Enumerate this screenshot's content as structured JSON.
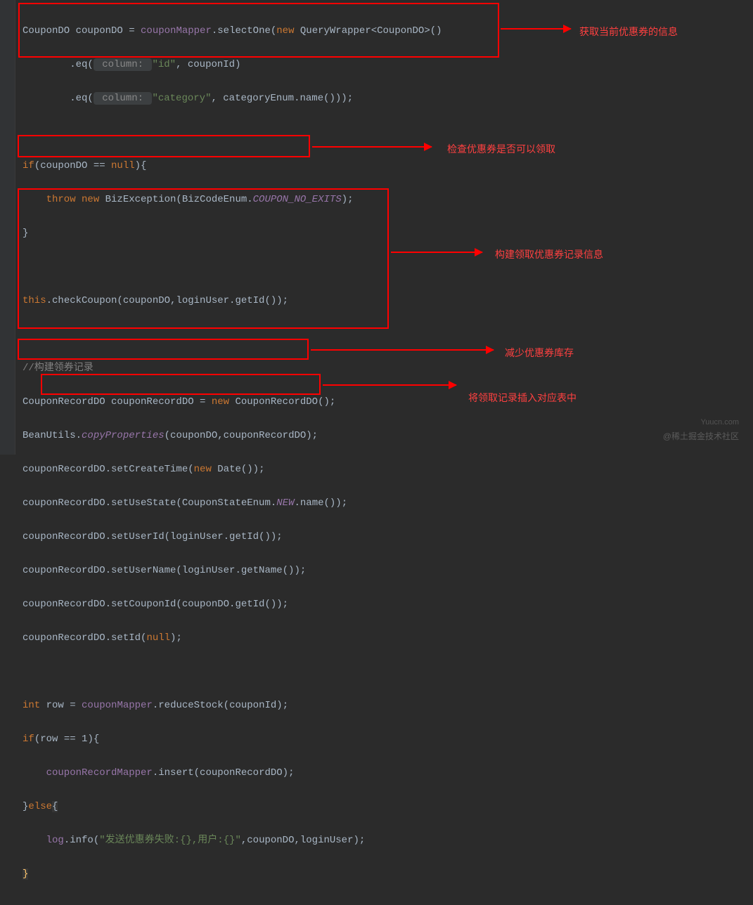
{
  "code": {
    "l1a": "CouponDO couponDO = ",
    "l1b": "couponMapper",
    "l1c": ".selectOne(",
    "l1d": "new",
    "l1e": " QueryWrapper<CouponDO>()",
    "l2a": "        .eq(",
    "l2h": " column: ",
    "l2b": "\"id\"",
    "l2c": ", couponId)",
    "l3a": "        .eq(",
    "l3h": " column: ",
    "l3b": "\"category\"",
    "l3c": ", categoryEnum.name()));",
    "l5a": "if",
    "l5b": "(couponDO == ",
    "l5c": "null",
    "l5d": "){",
    "l6a": "    throw new",
    "l6b": " BizException(BizCodeEnum.",
    "l6c": "COUPON_NO_EXITS",
    "l6d": ");",
    "l7a": "}",
    "l9a": "this",
    "l9b": ".checkCoupon(couponDO,loginUser.getId());",
    "l11a": "//构建领券记录",
    "l12a": "CouponRecordDO couponRecordDO = ",
    "l12b": "new",
    "l12c": " CouponRecordDO();",
    "l13a": "BeanUtils.",
    "l13b": "copyProperties",
    "l13c": "(couponDO,couponRecordDO);",
    "l14a": "couponRecordDO.setCreateTime(",
    "l14b": "new",
    "l14c": " Date());",
    "l15a": "couponRecordDO.setUseState(CouponStateEnum.",
    "l15b": "NEW",
    "l15c": ".name());",
    "l16a": "couponRecordDO.setUserId(loginUser.getId());",
    "l17a": "couponRecordDO.setUserName(loginUser.getName());",
    "l18a": "couponRecordDO.setCouponId(couponDO.getId());",
    "l19a": "couponRecordDO.setId(",
    "l19b": "null",
    "l19c": ");",
    "l21a": "int",
    "l21b": " row = ",
    "l21c": "couponMapper",
    "l21d": ".reduceStock(couponId);",
    "l22a": "if",
    "l22b": "(row == ",
    "l22c": "1",
    "l22d": "){",
    "l23a": "    couponRecordMapper",
    "l23b": ".insert(couponRecordDO);",
    "l24a": "}",
    "l24b": "else",
    "l24c": "{",
    "l25a": "    log",
    "l25b": ".info(",
    "l25c": "\"发送优惠券失败:{},用户:{}\"",
    "l25d": ",couponDO,loginUser);",
    "l26a": "}"
  },
  "annotations": {
    "a1": "获取当前优惠券的信息",
    "a2": "检查优惠券是否可以领取",
    "a3": "构建领取优惠券记录信息",
    "a4": "减少优惠券库存",
    "a5": "将领取记录插入对应表中"
  },
  "watermark": {
    "w1": "Yuucn.com",
    "w2": "@稀土掘金技术社区"
  }
}
